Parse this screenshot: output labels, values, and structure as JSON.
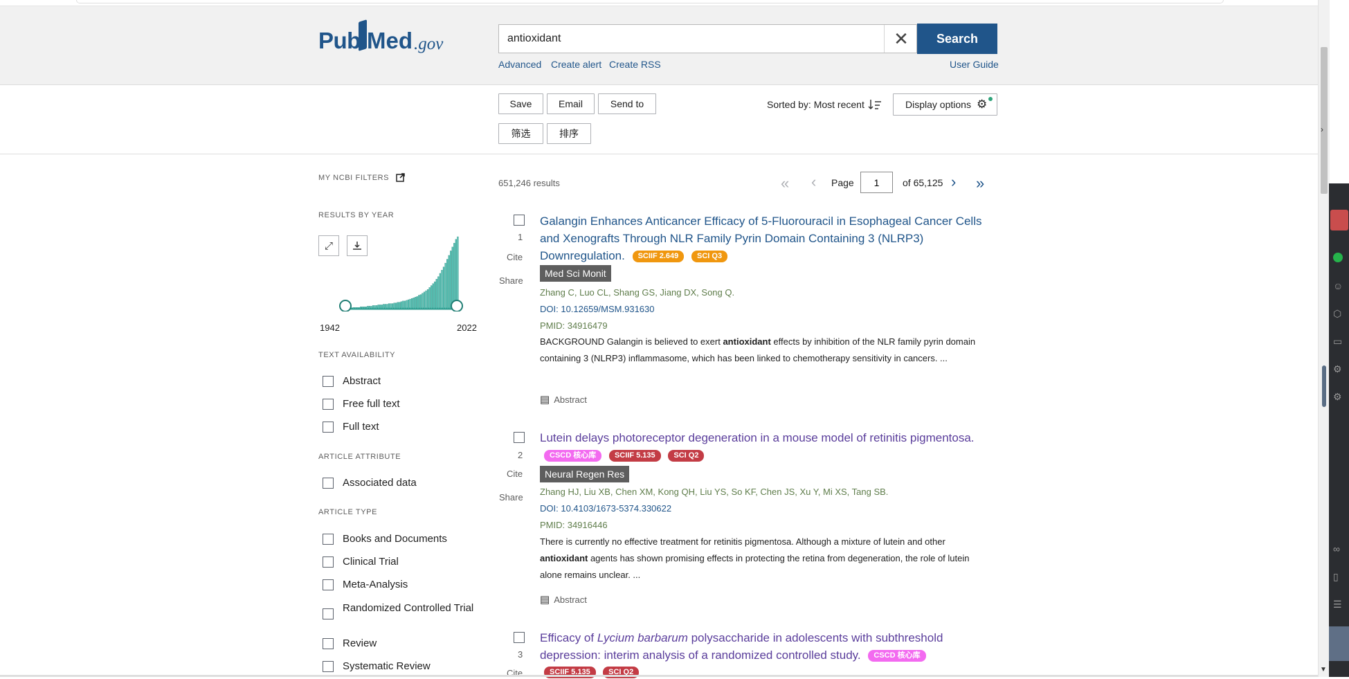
{
  "header": {
    "logo_pub": "Pub",
    "logo_med": "Med",
    "logo_gov": ".gov",
    "search_value": "antioxidant",
    "search_button": "Search",
    "links": [
      "Advanced",
      "Create alert",
      "Create RSS"
    ],
    "user_guide": "User Guide"
  },
  "toolbar": {
    "save": "Save",
    "email": "Email",
    "send_to": "Send to",
    "filter": "筛选",
    "sort": "排序",
    "sorted_by": "Sorted by: Most recent",
    "display_options": "Display options"
  },
  "sidebar": {
    "my_ncbi_filters": "MY NCBI FILTERS",
    "results_by_year": "RESULTS BY YEAR",
    "year_start": "1942",
    "year_end": "2022",
    "text_availability": {
      "title": "TEXT AVAILABILITY",
      "items": [
        "Abstract",
        "Free full text",
        "Full text"
      ]
    },
    "article_attribute": {
      "title": "ARTICLE ATTRIBUTE",
      "items": [
        "Associated data"
      ]
    },
    "article_type": {
      "title": "ARTICLE TYPE",
      "items": [
        "Books and Documents",
        "Clinical Trial",
        "Meta-Analysis",
        "Randomized Controlled Trial",
        "Review",
        "Systematic Review"
      ]
    }
  },
  "results": {
    "count": "651,246 results",
    "page_label": "Page",
    "page_value": "1",
    "page_of": "of 65,125",
    "items": [
      {
        "number": "1",
        "title": "Galangin Enhances Anticancer Efficacy of 5-Fluorouracil in Esophageal Cancer Cells and Xenografts Through NLR Family Pyrin Domain Containing 3 (NLRP3) Downregulation.",
        "badges": [
          "SCIIF 2.649",
          "SCI Q3"
        ],
        "journal": "Med Sci Monit",
        "authors": "Zhang C, Luo CL, Shang GS, Jiang DX, Song Q.",
        "doi": "DOI: 10.12659/MSM.931630",
        "pmid": "PMID: 34916479",
        "snippet_pre": "BACKGROUND Galangin is believed to exert ",
        "snippet_bold": "antioxidant",
        "snippet_post": " effects by inhibition of the NLR family pyrin domain containing 3 (NLRP3) inflammasome, which has been linked to chemotherapy sensitivity in cancers. ..."
      },
      {
        "number": "2",
        "title": "Lutein delays photoreceptor degeneration in a mouse model of retinitis pigmentosa.",
        "badges": [
          "CSCD 核心库",
          "SCIIF 5.135",
          "SCI Q2"
        ],
        "journal": "Neural Regen Res",
        "authors": "Zhang HJ, Liu XB, Chen XM, Kong QH, Liu YS, So KF, Chen JS, Xu Y, Mi XS, Tang SB.",
        "doi": "DOI: 10.4103/1673-5374.330622",
        "pmid": "PMID: 34916446",
        "snippet_pre": "There is currently no effective treatment for retinitis pigmentosa. Although a mixture of lutein and other ",
        "snippet_bold": "antioxidant",
        "snippet_post": " agents has shown promising effects in protecting the retina from degeneration, the role of lutein alone remains unclear. ..."
      },
      {
        "number": "3",
        "title_pre": "Efficacy of ",
        "title_italic": "Lycium barbarum",
        "title_post": " polysaccharide in adolescents with subthreshold depression: interim analysis of a randomized controlled study.",
        "badges": [
          "CSCD 核心库",
          "SCIIF 5.135",
          "SCI Q2"
        ]
      }
    ],
    "cite": "Cite",
    "share": "Share",
    "abstract": "Abstract"
  },
  "histogram_values": [
    2,
    2,
    2,
    2,
    3,
    3,
    3,
    3,
    4,
    4,
    4,
    5,
    5,
    5,
    6,
    6,
    6,
    7,
    7,
    7,
    8,
    8,
    8,
    9,
    9,
    10,
    10,
    11,
    12,
    12,
    13,
    14,
    15,
    16,
    17,
    18,
    19,
    21,
    22,
    24,
    26,
    28,
    30,
    33,
    36,
    39,
    42,
    46,
    50,
    55,
    60,
    65,
    71,
    77,
    83,
    90,
    96,
    102,
    108,
    112
  ]
}
